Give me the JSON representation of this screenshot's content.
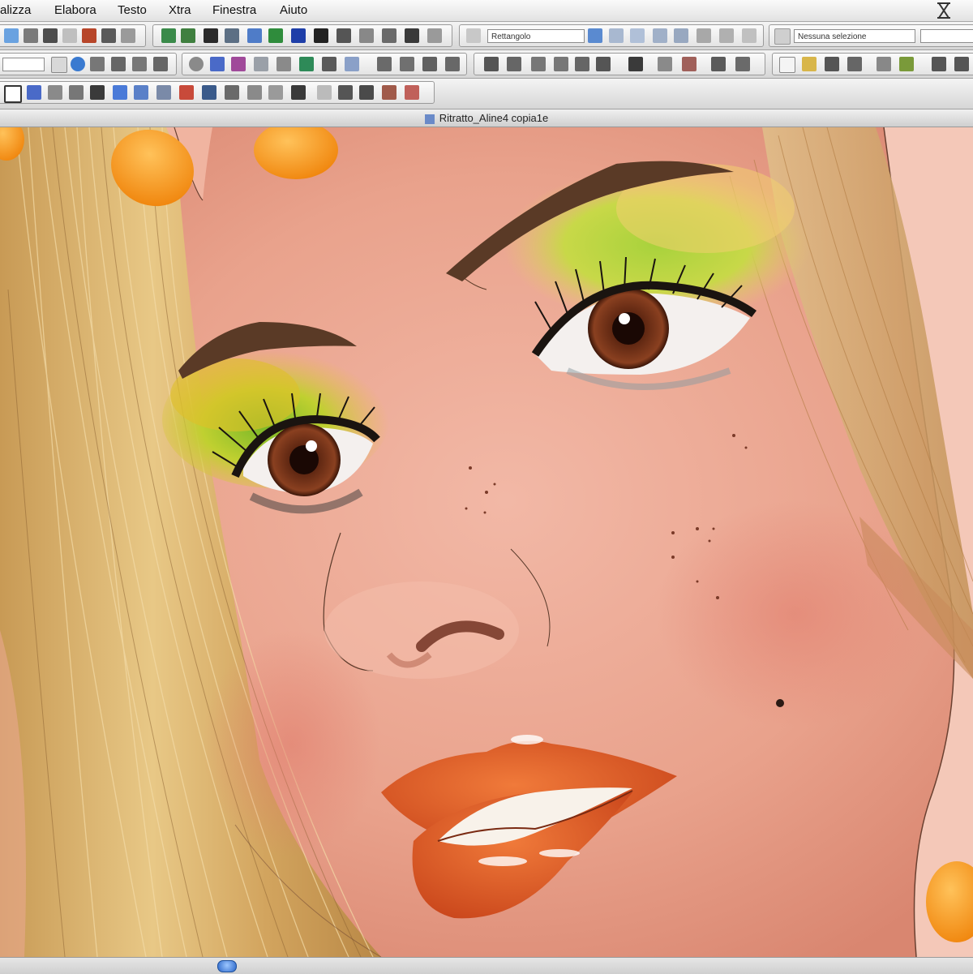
{
  "menubar": {
    "items": [
      "alizza",
      "Elabora",
      "Testo",
      "Xtra",
      "Finestra",
      "Aiuto"
    ]
  },
  "toolbar": {
    "style_field": "Rettangolo",
    "selection_field": "Nessuna selezione",
    "icons": [
      "rectangle-tool-icon",
      "pointer-tool-icon",
      "subselect-tool-icon",
      "pen-tool-icon",
      "knife-tool-icon",
      "zoom-tool-icon",
      "eyedropper-tool-icon",
      "hand-tool-icon",
      "new-document-icon",
      "open-icon",
      "save-icon",
      "print-icon",
      "undo-icon",
      "redo-icon"
    ]
  },
  "document": {
    "title": "Ritratto_Aline4 copia1e"
  },
  "colors": {
    "skin": "#eca08c",
    "hair": "#d9b06a",
    "lips": "#e4561f",
    "eyeshadow": "#9cc23b",
    "nail": "#f49a1c",
    "iris": "#6a2e18",
    "accent": "#2a66c8"
  }
}
